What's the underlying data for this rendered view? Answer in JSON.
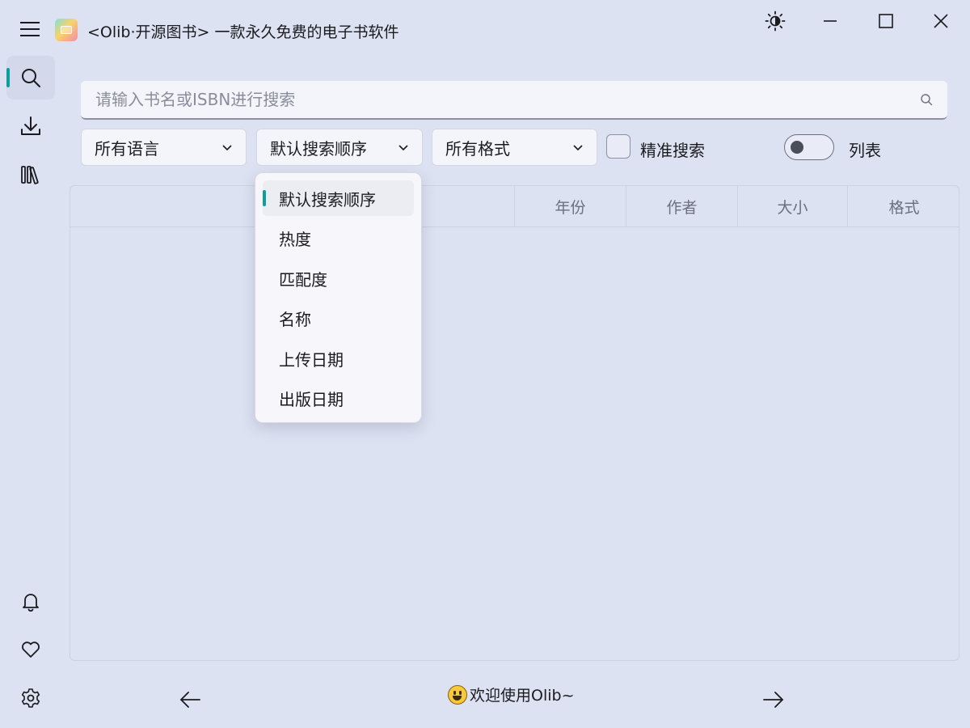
{
  "window": {
    "title": "<Olib·开源图书> 一款永久免费的电子书软件"
  },
  "sidebar": {
    "items": [
      {
        "name": "search",
        "icon": "search-icon",
        "active": true
      },
      {
        "name": "downloads",
        "icon": "download-icon",
        "active": false
      },
      {
        "name": "library",
        "icon": "library-icon",
        "active": false
      }
    ],
    "bottom_items": [
      {
        "name": "notifications",
        "icon": "bell-icon"
      },
      {
        "name": "favorites",
        "icon": "heart-icon"
      },
      {
        "name": "settings",
        "icon": "gear-icon"
      }
    ],
    "accent_color": "#0f9e9e"
  },
  "search": {
    "placeholder": "请输入书名或ISBN进行搜索",
    "value": ""
  },
  "filters": {
    "language": "所有语言",
    "sort": "默认搜索顺序",
    "format": "所有格式",
    "exact_search_label": "精准搜索",
    "exact_search_checked": false,
    "list_view_label": "列表",
    "list_view_on": false
  },
  "table": {
    "columns": [
      "年份",
      "作者",
      "大小",
      "格式"
    ]
  },
  "sort_menu": {
    "options": [
      "默认搜索顺序",
      "热度",
      "匹配度",
      "名称",
      "上传日期",
      "出版日期"
    ],
    "selected_index": 0
  },
  "footer": {
    "welcome": "欢迎使用Olib~"
  }
}
